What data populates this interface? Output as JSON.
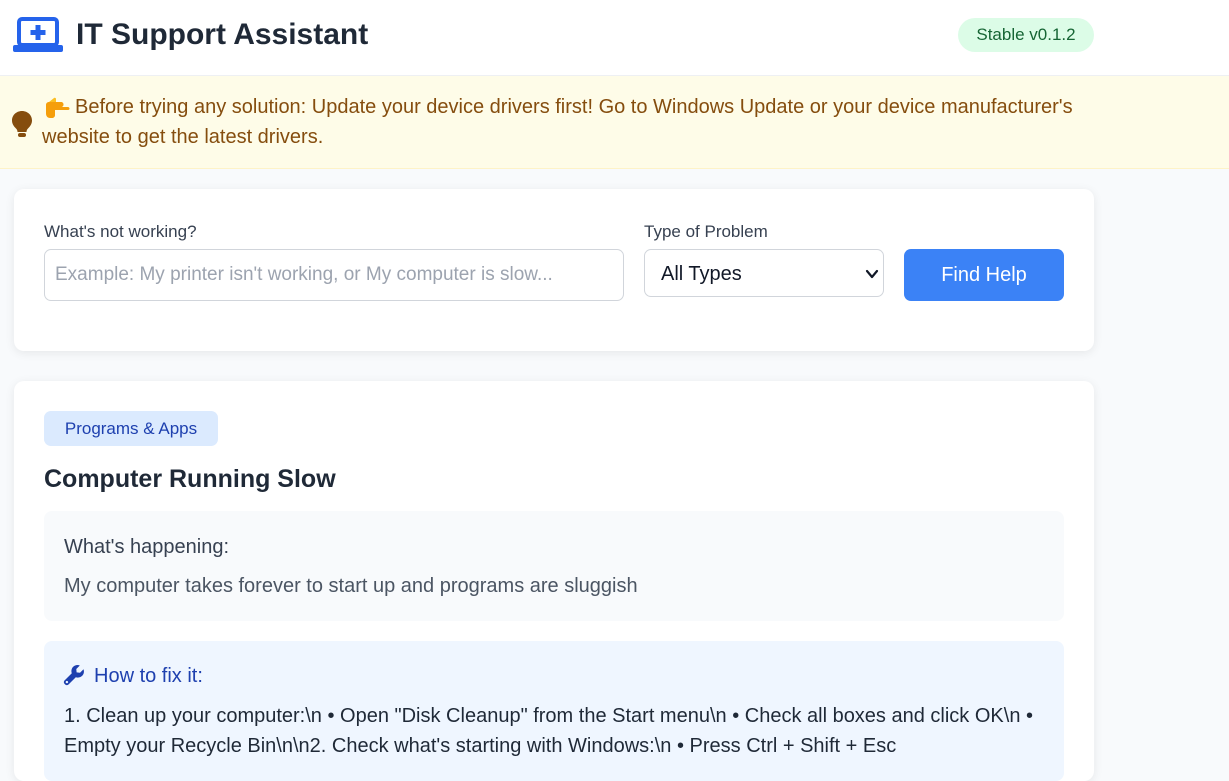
{
  "header": {
    "title": "IT Support Assistant",
    "version": "Stable v0.1.2",
    "logo_icon": "laptop-plus-icon"
  },
  "notice": {
    "icon": "lightbulb-icon",
    "pointer_icon": "pointing-hand-icon",
    "text": "Before trying any solution: Update your device drivers first! Go to Windows Update or your device manufacturer's website to get the latest drivers."
  },
  "search": {
    "problem_label": "What's not working?",
    "problem_placeholder": "Example: My printer isn't working, or My computer is slow...",
    "problem_value": "",
    "type_label": "Type of Problem",
    "type_selected": "All Types",
    "submit_label": "Find Help"
  },
  "result": {
    "category": "Programs & Apps",
    "title": "Computer Running Slow",
    "happening_label": "What's happening:",
    "happening_text": "My computer takes forever to start up and programs are sluggish",
    "fix_label": "How to fix it:",
    "fix_icon": "wrench-icon",
    "fix_text": "1. Clean up your computer:\\n • Open \"Disk Cleanup\" from the Start menu\\n • Check all boxes and click OK\\n • Empty your Recycle Bin\\n\\n2. Check what's starting with Windows:\\n • Press Ctrl + Shift + Esc"
  },
  "colors": {
    "primary": "#3b82f6",
    "badge_green_bg": "#dcfce7",
    "badge_green_text": "#166534",
    "notice_bg": "#fefce8",
    "notice_text": "#854d0e",
    "category_bg": "#dbeafe",
    "category_text": "#1e40af"
  }
}
